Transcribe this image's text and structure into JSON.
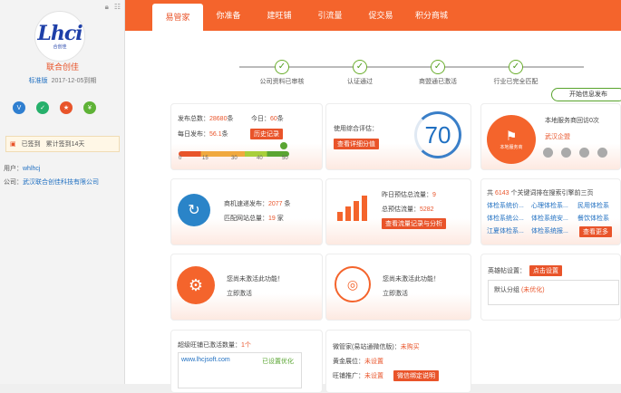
{
  "sidebar": {
    "logo_text": "Lhci",
    "logo_sub": "合创佳",
    "company": "联合创佳",
    "edition": "标准版",
    "expire": "2017-12-05到期",
    "sign_in": "已签到",
    "sign_days": "累计签到14天",
    "user_label": "用户：",
    "user": "whlhcj",
    "company_label": "公司：",
    "company_full": "武汉联合创佳科技有限公司",
    "icon_colors": [
      "#2f7fd0",
      "#26b06b",
      "#e8542a",
      "#5eb236"
    ]
  },
  "nav": {
    "tabs": [
      "易管家",
      "你准备",
      "建旺铺",
      "引流量",
      "促交易",
      "积分商城"
    ],
    "active": 0
  },
  "progress": {
    "steps": [
      "公司资料已审核",
      "认证通过",
      "商盟通已激活",
      "行业已完全匹配"
    ],
    "final": "开始信息发布"
  },
  "stats": {
    "total_label": "发布总数：",
    "total": "28680",
    "total_unit": "条",
    "today_label": "今日：",
    "today": "60",
    "today_unit": "条",
    "daily_label": "每日发布：",
    "daily": "56.1",
    "daily_unit": "条",
    "history_btn": "历史记录",
    "ticks": [
      "0",
      "15",
      "30",
      "40",
      "50"
    ]
  },
  "score": {
    "label": "使用综合评估：",
    "btn": "查看详细分值",
    "value": "70"
  },
  "service": {
    "title": "本地服务商回访0次",
    "city": "武汉企盟",
    "badge": "本地服务商"
  },
  "merchant": {
    "label1": "商机速递发布：",
    "v1": "2077",
    "u1": "条",
    "label2": "匹配网站总量：",
    "v2": "19",
    "u2": "家"
  },
  "traffic": {
    "label1": "昨日预估总流量：",
    "v1": "9",
    "label2": "总预估流量：",
    "v2": "5282",
    "btn": "查看流量记录与分析"
  },
  "keywords": {
    "intro_a": "共 ",
    "count": "6143",
    "intro_b": " 个关键词排在搜索引擎前三页",
    "items": [
      "体检系统价...",
      "心理体检系...",
      "民用体检系",
      "体检系统公...",
      "体检系统安...",
      "餐饮体检系",
      "江夏体检系...",
      "体检系统报..."
    ],
    "more": "查看更多"
  },
  "act1": {
    "text": "您尚未激活此功能！",
    "link": "立即激活"
  },
  "act2": {
    "text": "您尚未激活此功能！",
    "link": "立即激活"
  },
  "hero": {
    "label": "英雄帖设置：",
    "btn": "点击设置",
    "group": "默认分组",
    "opt": "(未优化)"
  },
  "shops": {
    "label": "超级旺铺已激活数量：",
    "count": "1个",
    "url": "www.lhcjsoft.com",
    "status": "已设置优化"
  },
  "wechat": {
    "l1": "微管家(易站通微信版)：",
    "v1": "未购买",
    "l2": "黄金展位：",
    "v2": "未设置",
    "l3": "旺铺推广：",
    "v3": "未设置",
    "btn": "微信绑定说明"
  }
}
